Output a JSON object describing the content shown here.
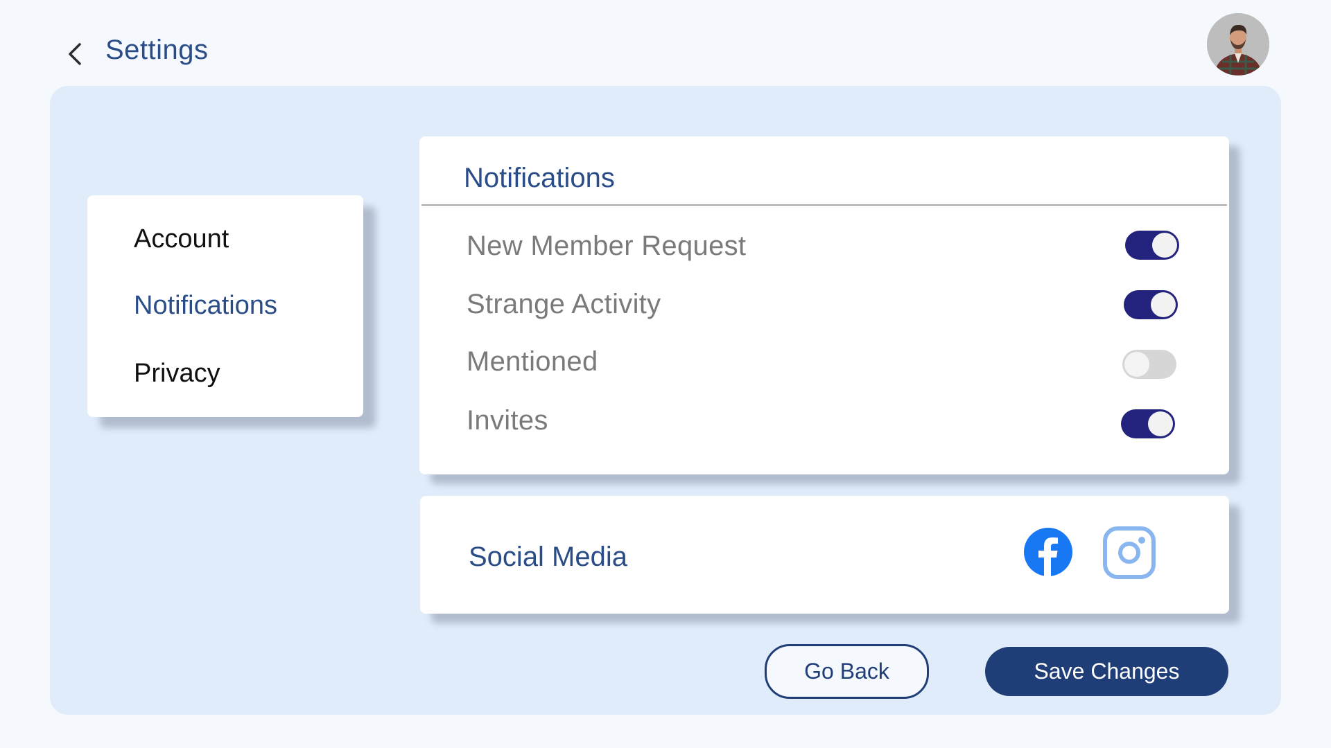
{
  "header": {
    "title": "Settings",
    "back_icon": "chevron-left-icon",
    "avatar": "user-avatar"
  },
  "sidebar": {
    "items": [
      {
        "label": "Account",
        "active": false
      },
      {
        "label": "Notifications",
        "active": true
      },
      {
        "label": "Privacy",
        "active": false
      }
    ]
  },
  "notifications": {
    "title": "Notifications",
    "rows": [
      {
        "label": "New Member Request",
        "enabled": true
      },
      {
        "label": "Strange Activity",
        "enabled": true
      },
      {
        "label": "Mentioned",
        "enabled": false
      },
      {
        "label": "Invites",
        "enabled": true
      }
    ]
  },
  "social": {
    "title": "Social Media",
    "icons": [
      "facebook-icon",
      "instagram-icon"
    ]
  },
  "actions": {
    "back_label": "Go Back",
    "save_label": "Save Changes"
  },
  "colors": {
    "accent": "#2a4d88",
    "toggle_on": "#23237e",
    "toggle_off": "#d6d6d6",
    "panel": "#e1ecfb",
    "button_primary": "#1f3e77",
    "facebook": "#1877f2",
    "instagram": "#8ab6f0"
  }
}
